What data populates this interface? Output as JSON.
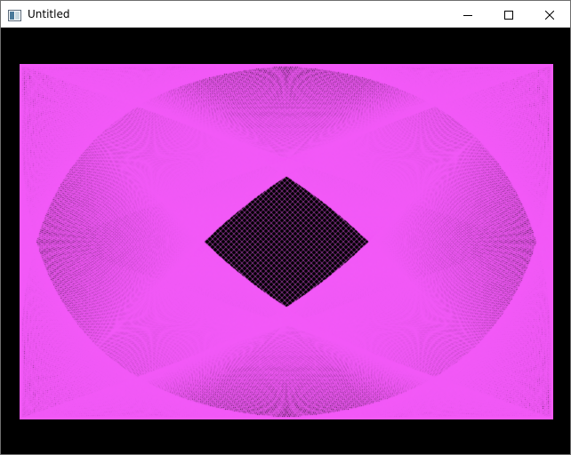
{
  "window": {
    "title": "Untitled",
    "icon": "app-window-icon",
    "controls": {
      "minimize": "minimize-icon",
      "maximize": "maximize-icon",
      "close": "close-icon"
    }
  },
  "canvas": {
    "background_color": "#000000",
    "pattern_color": "#f25af7",
    "pattern_description_icon": "moire-line-pattern"
  }
}
